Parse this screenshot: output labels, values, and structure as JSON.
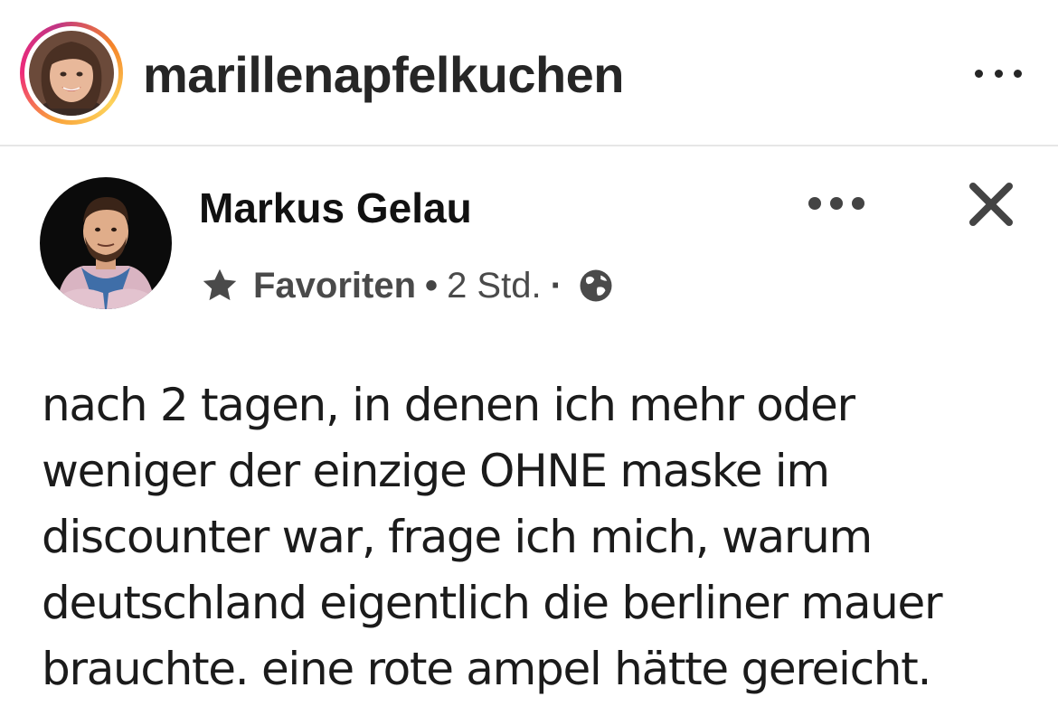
{
  "instagram": {
    "username": "marillenapfelkuchen",
    "more_icon": "more-horizontal-icon"
  },
  "post": {
    "author": "Markus Gelau",
    "audience_label": "Favoriten",
    "separator": "•",
    "time": "2 Std.",
    "separator_2": "·",
    "text_lines": [
      "nach 2 tagen, in denen ich mehr oder",
      "weniger der einzige OHNE maske im",
      "discounter war, frage ich mich, warum",
      "deutschland eigentlich die berliner mauer",
      "brauchte. eine rote ampel hätte gereicht."
    ],
    "icons": {
      "favorites": "star-icon",
      "privacy": "globe-icon",
      "more": "more-horizontal-icon",
      "close": "close-icon"
    }
  },
  "colors": {
    "ring_start": "#f9a23a",
    "ring_end": "#c13584",
    "text": "#1b1b1b",
    "meta": "#4a4a4a"
  }
}
